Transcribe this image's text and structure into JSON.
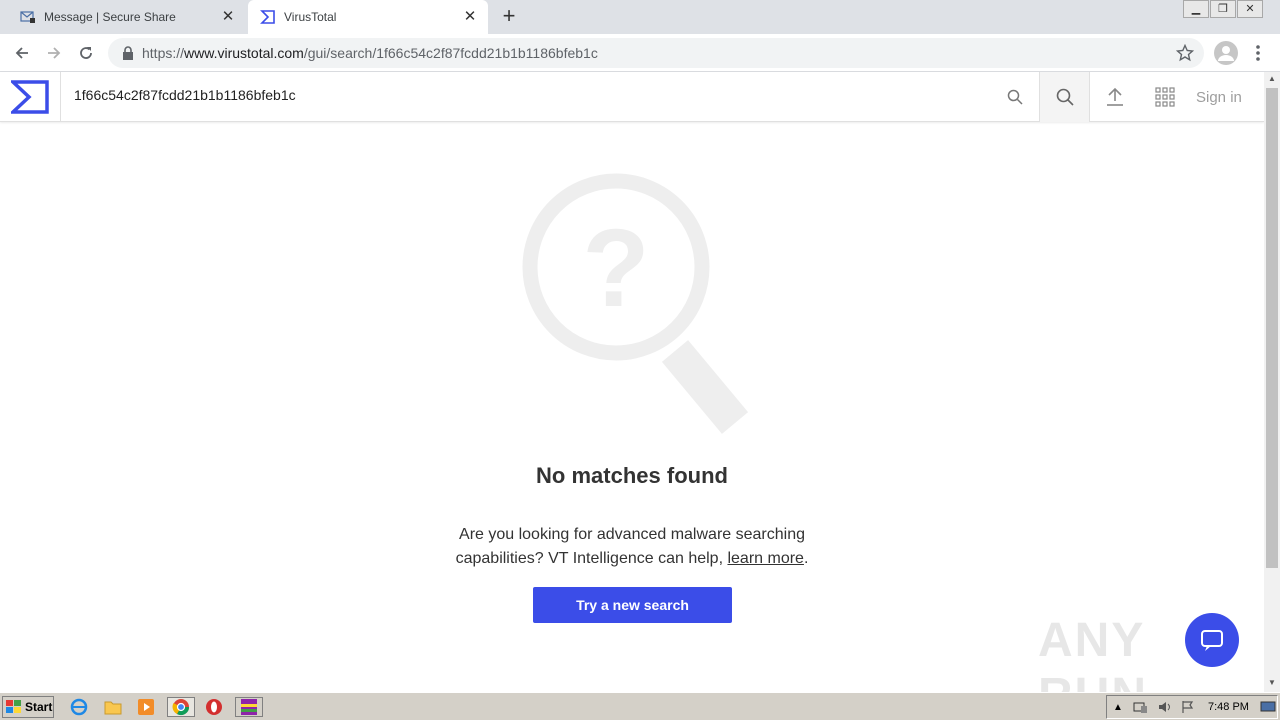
{
  "tabs": [
    {
      "label": "Message | Secure Share",
      "icon": "mail-lock-icon",
      "active": false
    },
    {
      "label": "VirusTotal",
      "icon": "virustotal-logo-icon",
      "active": true
    }
  ],
  "address": {
    "protocol": "https://",
    "host": "www.virustotal.com",
    "path": "/gui/search/1f66c54c2f87fcdd21b1b1186bfeb1c"
  },
  "vt_header": {
    "search_value": "1f66c54c2f87fcdd21b1b1186bfeb1c",
    "signin_label": "Sign in"
  },
  "main": {
    "heading": "No matches found",
    "promo_text": "Are you looking for advanced malware searching capabilities? VT Intelligence can help, ",
    "promo_link": "learn more",
    "promo_end": ".",
    "button_label": "Try a new search"
  },
  "watermark": "ANY RUN",
  "taskbar": {
    "start_label": "Start",
    "clock": "7:48 PM"
  },
  "colors": {
    "accent": "#3b4de8",
    "tabbar": "#dee1e6",
    "taskbar": "#d4d0c8"
  }
}
